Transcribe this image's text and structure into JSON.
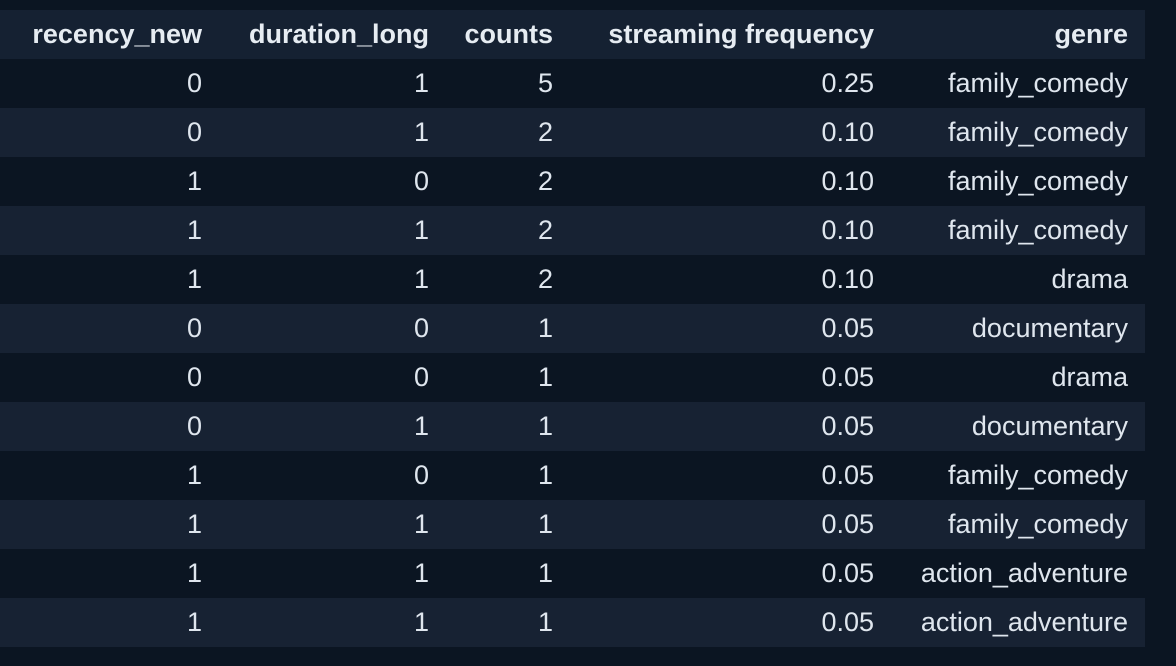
{
  "table": {
    "columns": [
      "recency_new",
      "duration_long",
      "counts",
      "streaming frequency",
      "genre"
    ],
    "rows": [
      [
        "0",
        "1",
        "5",
        "0.25",
        "family_comedy"
      ],
      [
        "0",
        "1",
        "2",
        "0.10",
        "family_comedy"
      ],
      [
        "1",
        "0",
        "2",
        "0.10",
        "family_comedy"
      ],
      [
        "1",
        "1",
        "2",
        "0.10",
        "family_comedy"
      ],
      [
        "1",
        "1",
        "2",
        "0.10",
        "drama"
      ],
      [
        "0",
        "0",
        "1",
        "0.05",
        "documentary"
      ],
      [
        "0",
        "0",
        "1",
        "0.05",
        "drama"
      ],
      [
        "0",
        "1",
        "1",
        "0.05",
        "documentary"
      ],
      [
        "1",
        "0",
        "1",
        "0.05",
        "family_comedy"
      ],
      [
        "1",
        "1",
        "1",
        "0.05",
        "family_comedy"
      ],
      [
        "1",
        "1",
        "1",
        "0.05",
        "action_adventure"
      ],
      [
        "1",
        "1",
        "1",
        "0.05",
        "action_adventure"
      ]
    ]
  },
  "colors": {
    "background": "#0b1522",
    "header_background": "#152132",
    "row_stripe": "#172233",
    "text": "#dfe6ee"
  }
}
